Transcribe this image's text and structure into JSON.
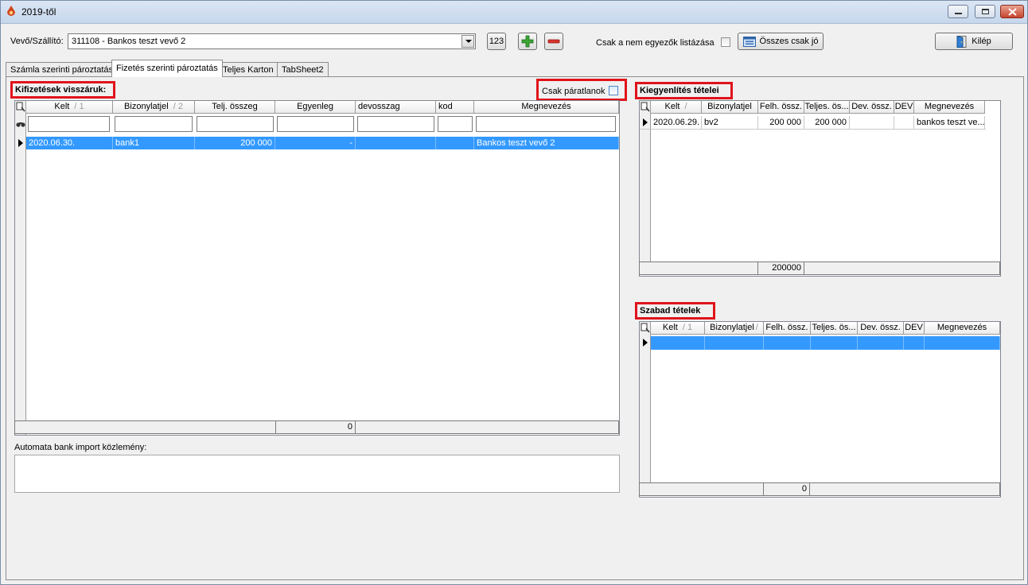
{
  "window": {
    "title": "2019-től"
  },
  "toolbar": {
    "partner_label": "Vevő/Szállító:",
    "partner_value": "311108 - Bankos teszt vevő 2",
    "btn_123": "123",
    "only_mismatch_label": "Csak a nem egyezők listázása",
    "all_ok_label": "Összes csak jó",
    "exit_label": "Kilép"
  },
  "tabs": [
    {
      "label": "Számla szerinti pároztatás"
    },
    {
      "label": "Fizetés szerinti pároztatás"
    },
    {
      "label": "Teljes Karton"
    },
    {
      "label": "TabSheet2"
    }
  ],
  "payments": {
    "title": "Kifizetések visszáruk:",
    "only_unpaired_label": "Csak páratlanok",
    "columns": [
      "Kelt",
      "Bizonylatjel",
      "Telj. összeg",
      "Egyenleg",
      "devosszag",
      "kod",
      "Megnevezés"
    ],
    "sort_marks": [
      "1",
      "2"
    ],
    "rows": [
      {
        "kelt": "2020.06.30.",
        "bizonylatjel": "bank1",
        "telj_osszeg": "200 000",
        "egyenleg": "-",
        "devosszag": "",
        "kod": "",
        "megnevezes": "Bankos teszt vevő 2"
      }
    ],
    "footer_total": "0"
  },
  "bank_import": {
    "label": "Automata bank import közlemény:",
    "value": ""
  },
  "settlement": {
    "title": "Kiegyenlítés tételei",
    "columns": [
      "Kelt",
      "Bizonylatjel",
      "Felh. össz.",
      "Teljes. ös...",
      "Dev. össz.",
      "DEV",
      "Megnevezés"
    ],
    "rows": [
      {
        "kelt": "2020.06.29.",
        "bizonylatjel": "bv2",
        "felh": "200 000",
        "teljes": "200 000",
        "dev_ossz": "",
        "dev": "",
        "megnevezes": "bankos teszt ve..."
      }
    ],
    "footer_total": "200000"
  },
  "free_items": {
    "title": "Szabad tételek",
    "columns": [
      "Kelt",
      "Bizonylatjel",
      "Felh. össz.",
      "Teljes. ös...",
      "Dev. össz.",
      "DEV",
      "Megnevezés"
    ],
    "sort_mark": "1",
    "footer_total": "0"
  },
  "colors": {
    "selection": "#3399ff",
    "highlight_border": "#e0131b",
    "add": "#3aa635",
    "remove": "#d9342b"
  }
}
